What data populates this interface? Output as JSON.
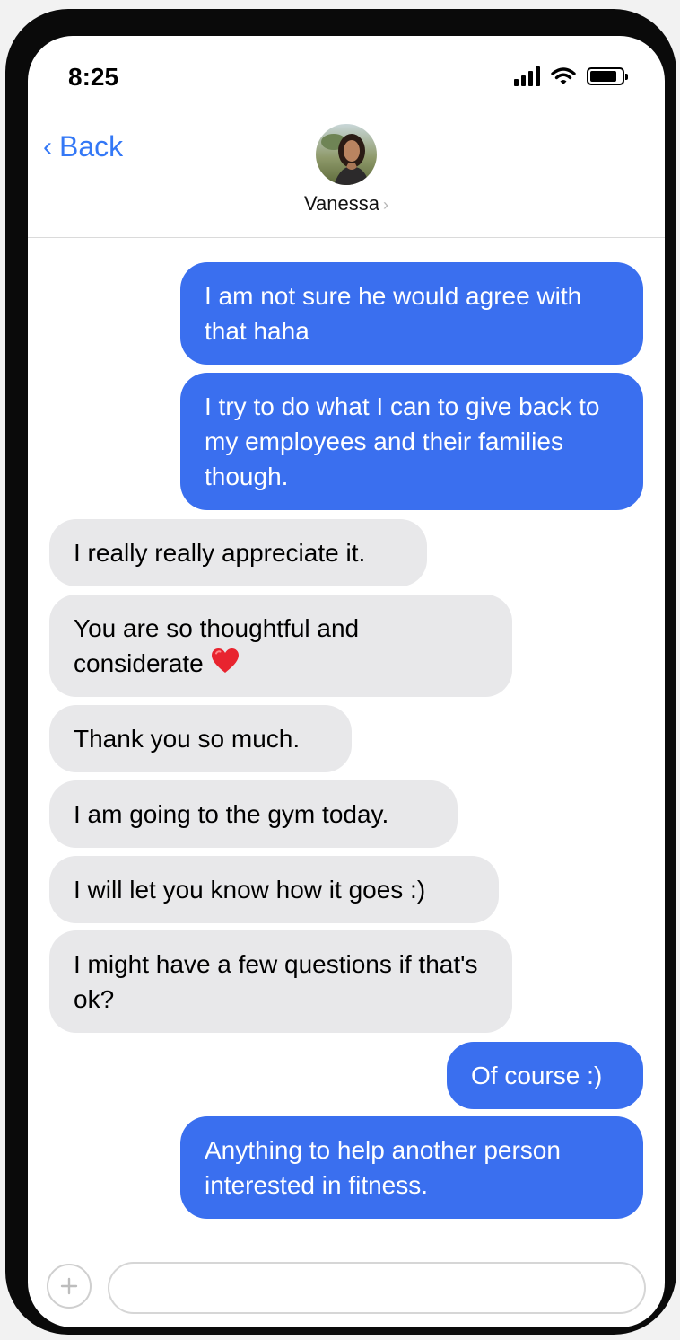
{
  "status_bar": {
    "time": "8:25",
    "signal_bars": 4,
    "battery_level": 0.85
  },
  "header": {
    "back_label": "Back",
    "contact_name": "Vanessa"
  },
  "messages": [
    {
      "direction": "sent",
      "text": "I am not sure he would agree with that haha"
    },
    {
      "direction": "sent",
      "text": "I try to do what I can to give back to my employees and their families though."
    },
    {
      "direction": "received",
      "text": "I really really appreciate it."
    },
    {
      "direction": "received",
      "text": "You are so thoughtful and considerate",
      "emoji": "red-heart"
    },
    {
      "direction": "received",
      "text": "Thank you so much."
    },
    {
      "direction": "received",
      "text": "I am going to the gym today."
    },
    {
      "direction": "received",
      "text": "I will let you know how it goes :)"
    },
    {
      "direction": "received",
      "text": "I might have a few questions if that's ok?"
    },
    {
      "direction": "sent",
      "text": "Of course :)"
    },
    {
      "direction": "sent",
      "text": "Anything to help another person interested in fitness."
    }
  ],
  "input": {
    "value": "",
    "placeholder": ""
  },
  "colors": {
    "sent_bubble": "#3a6fef",
    "received_bubble": "#e8e8ea",
    "accent": "#3478f6",
    "frame": "#0a0a0a"
  }
}
